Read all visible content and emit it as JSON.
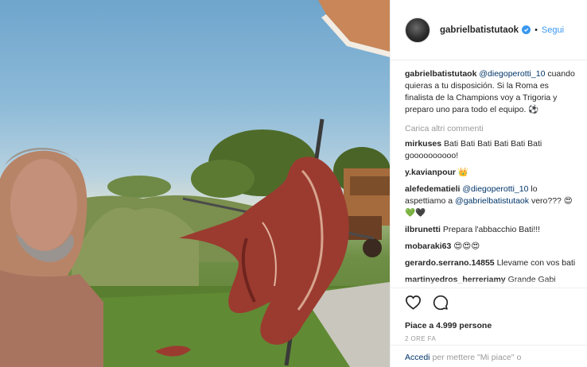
{
  "header": {
    "username": "gabrielbatistutaok",
    "separator": "•",
    "follow_label": "Segui"
  },
  "caption": {
    "username": "gabrielbatistutaok",
    "mention": "@diegoperotti_10",
    "text": "cuando quieras a tu disposición. Si la Roma es finalista de la Champions voy a Trigoria y preparo uno para todo el equipo. ⚽"
  },
  "load_more_label": "Carica altri commenti",
  "comments": [
    {
      "username": "mirkuses",
      "text": "Bati Bati Bati Bati Bati Bati goooooooooo!"
    },
    {
      "username": "y.kavianpour",
      "text": "👑"
    },
    {
      "username": "alefedematieli",
      "mention1": "@diegoperotti_10",
      "text1": "lo aspettiamo a",
      "mention2": "@gabrielbatistutaok",
      "text2": "vero??? 😍💚🖤"
    },
    {
      "username": "ilbrunetti",
      "text": "Prepara l'abbacchio Bati!!!"
    },
    {
      "username": "mobaraki63",
      "text": "😍😍😍"
    },
    {
      "username": "gerardo.serrano.14855",
      "text": "Llevame con vos bati"
    },
    {
      "username": "martinyedros_herreriamy",
      "text": "Grande Gabi"
    }
  ],
  "likes_text": "Piace a 4.999 persone",
  "timestamp": "2 ORE FA",
  "login": {
    "link": "Accedi",
    "text": "per mettere \"Mi piace\" o"
  },
  "colors": {
    "link_blue": "#3897f0",
    "mention_dark": "#003569",
    "muted": "#999999",
    "border": "#efefef"
  },
  "icons": [
    "verified-badge-icon",
    "heart-icon",
    "comment-icon"
  ]
}
